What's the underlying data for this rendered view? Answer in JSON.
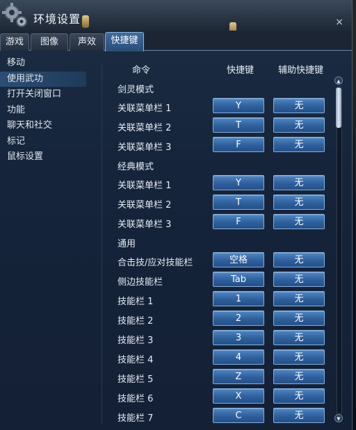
{
  "window": {
    "title": "环境设置",
    "close_label": "×"
  },
  "tabs": [
    {
      "label": "游戏"
    },
    {
      "label": "图像"
    },
    {
      "label": "声效"
    },
    {
      "label": "快捷键"
    }
  ],
  "sidebar": {
    "items": [
      {
        "label": "移动"
      },
      {
        "label": "使用武功"
      },
      {
        "label": "打开关闭窗口"
      },
      {
        "label": "功能"
      },
      {
        "label": "聊天和社交"
      },
      {
        "label": "标记"
      },
      {
        "label": "鼠标设置"
      }
    ]
  },
  "table": {
    "headers": {
      "command": "命令",
      "shortcut": "快捷键",
      "aux_shortcut": "辅助快捷键"
    },
    "sections": [
      {
        "title": "剑灵模式",
        "rows": [
          {
            "label": "关联菜单栏 1",
            "key": "Y",
            "aux": "无"
          },
          {
            "label": "关联菜单栏 2",
            "key": "T",
            "aux": "无"
          },
          {
            "label": "关联菜单栏 3",
            "key": "F",
            "aux": "无"
          }
        ]
      },
      {
        "title": "经典模式",
        "rows": [
          {
            "label": "关联菜单栏 1",
            "key": "Y",
            "aux": "无"
          },
          {
            "label": "关联菜单栏 2",
            "key": "T",
            "aux": "无"
          },
          {
            "label": "关联菜单栏 3",
            "key": "F",
            "aux": "无"
          }
        ]
      },
      {
        "title": "通用",
        "rows": [
          {
            "label": "合击技/应对技能栏",
            "key": "空格",
            "aux": "无"
          },
          {
            "label": "侧边技能栏",
            "key": "Tab",
            "aux": "无"
          },
          {
            "label": "技能栏 1",
            "key": "1",
            "aux": "无"
          },
          {
            "label": "技能栏 2",
            "key": "2",
            "aux": "无"
          },
          {
            "label": "技能栏 3",
            "key": "3",
            "aux": "无"
          },
          {
            "label": "技能栏 4",
            "key": "4",
            "aux": "无"
          },
          {
            "label": "技能栏 5",
            "key": "Z",
            "aux": "无"
          },
          {
            "label": "技能栏 6",
            "key": "X",
            "aux": "无"
          },
          {
            "label": "技能栏 7",
            "key": "C",
            "aux": "无"
          }
        ]
      }
    ]
  },
  "scrollbar": {
    "up_glyph": "▲",
    "down_glyph": "▼"
  },
  "colors": {
    "accent": "#3f6da0",
    "key_button": "#2e609c",
    "panel": "#15243a"
  }
}
